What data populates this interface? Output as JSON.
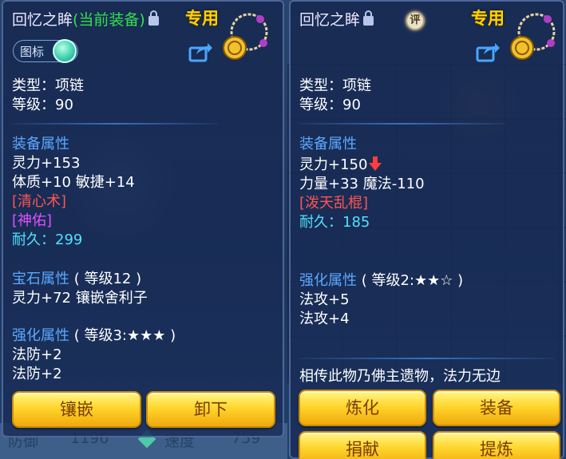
{
  "left": {
    "title_name": "回忆之眸",
    "title_status": "(当前装备)",
    "exclusive": "专用",
    "toggle_label": "图标",
    "type_line": "类型：项链",
    "level_line": "等级：90",
    "equip_attr_header": "装备属性",
    "attr1": "灵力+153",
    "attr2": "体质+10 敏捷+14",
    "skill1": "[清心术]",
    "skill2": "[神佑]",
    "durability_label": "耐久：",
    "durability_value": "299",
    "gem_header": "宝石属性",
    "gem_level": "( 等级12 )",
    "gem_attr": "灵力+72 镶嵌舍利子",
    "enhance_header": "强化属性",
    "enhance_level": "( 等级3:★★★ )",
    "enhance1": "法防+2",
    "enhance2": "法防+2",
    "btn_inlay": "镶嵌",
    "btn_unequip": "卸下"
  },
  "right": {
    "title_name": "回忆之眸",
    "rating_label": "评",
    "exclusive": "专用",
    "type_line": "类型：项链",
    "level_line": "等级：90",
    "equip_attr_header": "装备属性",
    "attr1": "灵力+150",
    "attr2": "力量+33 魔法-110",
    "skill1": "[泼天乱棍]",
    "durability_label": "耐久：",
    "durability_value": "185",
    "enhance_header": "强化属性",
    "enhance_level": "( 等级2:★★☆ )",
    "enhance1": "法攻+5",
    "enhance2": "法攻+4",
    "description": "相传此物乃佛主遗物，法力无边",
    "btn_refine": "炼化",
    "btn_equip": "装备",
    "btn_donate": "捐献",
    "btn_extract": "提炼"
  },
  "colors": {
    "attr_header": "#5ba8ff",
    "skill_red": "#ff5552",
    "skill_purple": "#e150ff",
    "durability": "#4fe2ff",
    "exclusive": "#ffd200",
    "button": "#ffd62e"
  },
  "icons": [
    "lock-icon",
    "rating-icon",
    "necklace-icon",
    "share-icon",
    "down-arrow-icon"
  ]
}
